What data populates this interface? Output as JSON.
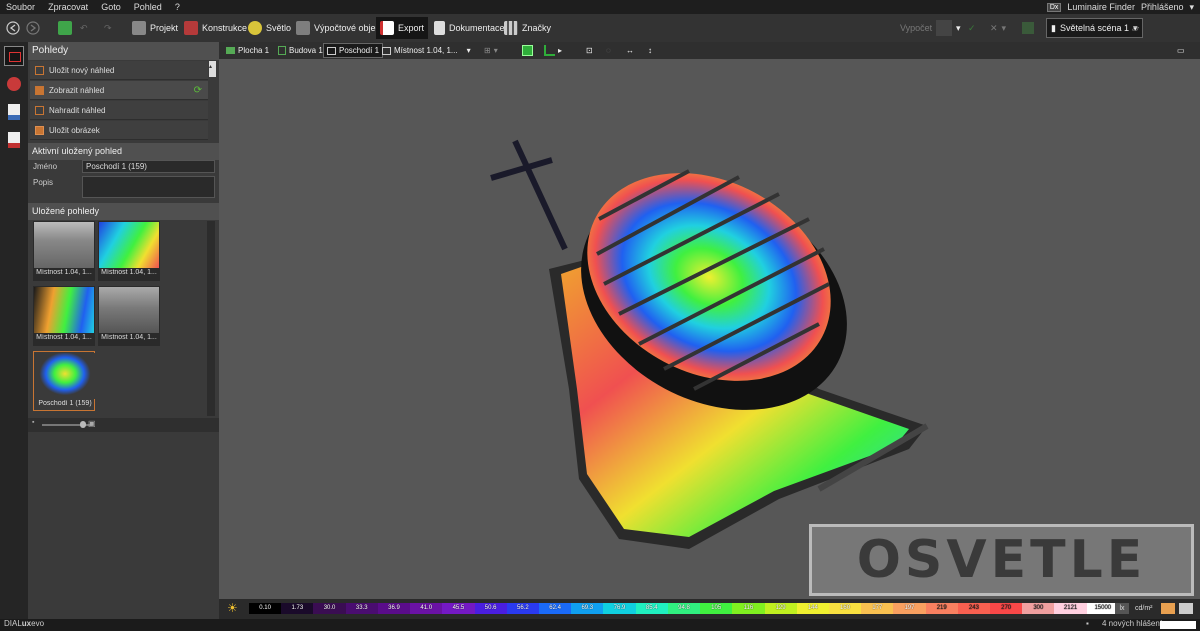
{
  "menu": {
    "items": [
      "Soubor",
      "Zpracovat",
      "Goto",
      "Pohled",
      "?"
    ],
    "luminaire_finder_badge": "Dx",
    "luminaire_finder": "Luminaire Finder",
    "login": "Přihlášeno"
  },
  "toolbar": {
    "tabs": [
      "Projekt",
      "Konstrukce",
      "Světlo",
      "Výpočtové objekty",
      "Export",
      "Dokumentace",
      "Značky"
    ],
    "active_tab": "Export",
    "calculate_label": "Vypočet",
    "scene_label": "Světelná scéna 1"
  },
  "panel": {
    "views_title": "Pohledy",
    "actions": [
      "Uložit nový náhled",
      "Zobrazit náhled",
      "Nahradit náhled",
      "Uložit obrázek"
    ],
    "active_view_title": "Aktivní uložený pohled",
    "name_label": "Jméno",
    "name_value": "Poschodí 1 (159)",
    "description_label": "Popis",
    "description_value": "",
    "saved_views_title": "Uložené pohledy",
    "saved_views": [
      {
        "caption": "Místnost 1.04, 1...",
        "style": "grey"
      },
      {
        "caption": "Místnost 1.04, 1...",
        "style": "false-color"
      },
      {
        "caption": "Místnost 1.04, 1...",
        "style": "false-color"
      },
      {
        "caption": "Místnost 1.04, 1...",
        "style": "grey"
      },
      {
        "caption": "Poschodí 1 (159)",
        "style": "false-color-floor"
      }
    ]
  },
  "view_tabs": [
    "Plocha 1",
    "Budova 1",
    "Poschodí 1",
    "Místnost 1.04, 1..."
  ],
  "active_view_tab": "Poschodí 1",
  "legend": {
    "values": [
      "0.10",
      "1.73",
      "30.0",
      "33.3",
      "36.9",
      "41.0",
      "45.5",
      "50.6",
      "56.2",
      "62.4",
      "69.3",
      "76.9",
      "85.4",
      "94.8",
      "105",
      "116",
      "129",
      "144",
      "160",
      "177",
      "197",
      "219",
      "243",
      "270",
      "300",
      "2121",
      "15000"
    ],
    "colors": [
      "#000000",
      "#1a0a2a",
      "#3a0d52",
      "#4a0d70",
      "#5a0c8a",
      "#6a12a4",
      "#7419c4",
      "#4a1ee0",
      "#2a3af0",
      "#1a6af8",
      "#10a0f0",
      "#10d0e0",
      "#20f0c0",
      "#30f080",
      "#40f040",
      "#80f020",
      "#c0f020",
      "#f0f030",
      "#f8e040",
      "#f8c050",
      "#f8a060",
      "#f88060",
      "#f86050",
      "#f84848",
      "#f0a0a0",
      "#ffd0e0",
      "#ffffff"
    ],
    "unit_lx": "lx",
    "unit_cd": "cd/m²"
  },
  "status": {
    "app_name_pre": "DIAL",
    "app_name_bold": "ux",
    "app_name_post": "evo",
    "notifications": "4 nových hlášení"
  },
  "watermark": "OSVETLE"
}
